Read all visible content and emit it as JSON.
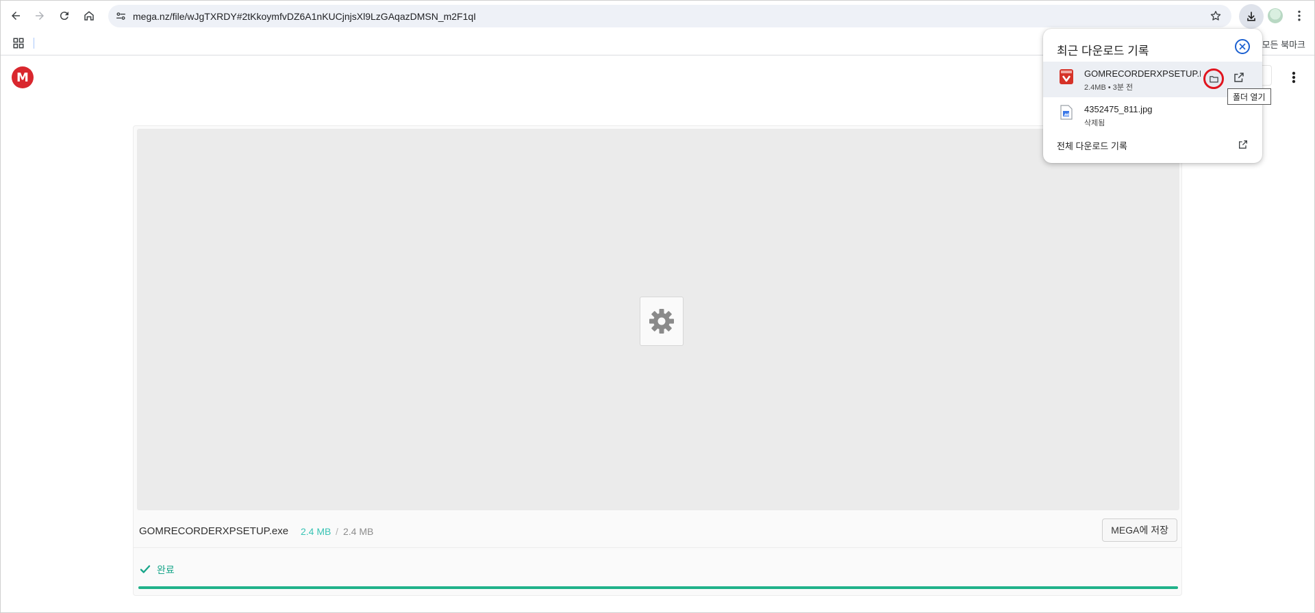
{
  "browser": {
    "url": "mega.nz/file/wJgTXRDY#2tKkoymfvDZ6A1nKUCjnjsXl9LzGAqazDMSN_m2F1qI",
    "all_bookmarks_label": "모든 북마크"
  },
  "download_panel": {
    "title": "최근 다운로드 기록",
    "items": [
      {
        "name": "GOMRECORDERXPSETUP.EXE",
        "meta": "2.4MB • 3분 전",
        "icon": "gom-app-icon"
      },
      {
        "name": "4352475_811.jpg",
        "meta": "삭제됨",
        "icon": "image-file-icon"
      }
    ],
    "all_downloads_label": "전체 다운로드 기록",
    "tooltip": "폴더 열기"
  },
  "mega": {
    "logo_letter": "M",
    "file_name": "GOMRECORDERXPSETUP.exe",
    "downloaded_size": "2.4 MB",
    "size_separator": "/",
    "total_size": "2.4 MB",
    "save_button": "MEGA에 저장",
    "status": "완료",
    "progress_fraction": 1.0,
    "colors": {
      "accent": "#20b28a",
      "status_text": "#17a589",
      "logo": "#d9272e"
    }
  }
}
